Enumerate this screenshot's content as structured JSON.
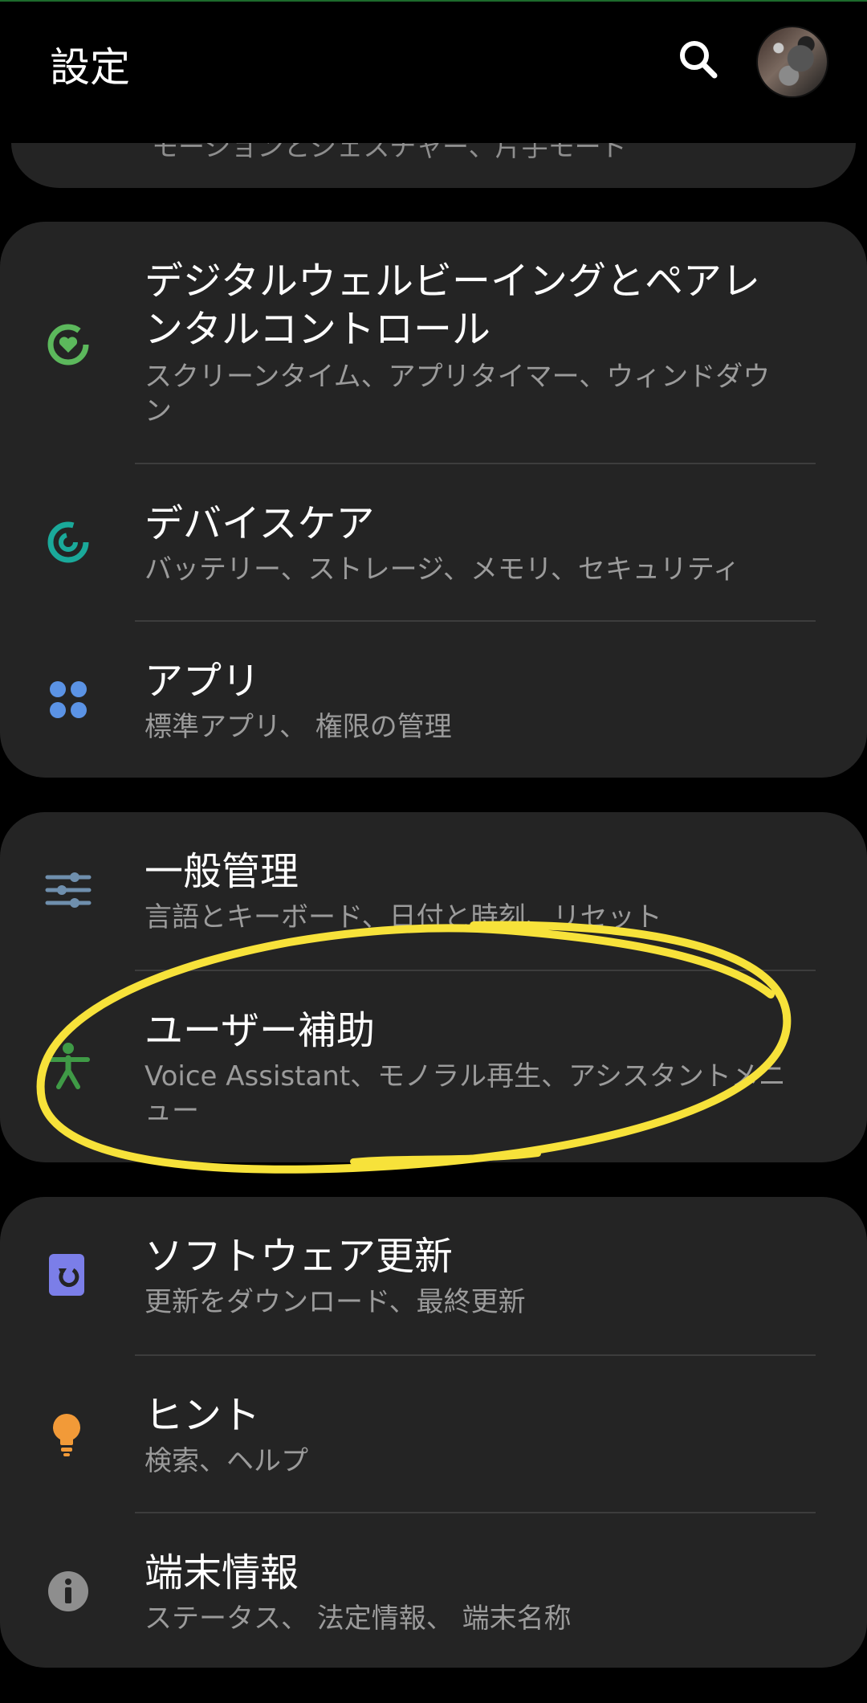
{
  "header": {
    "title": "設定",
    "search_icon": "search-icon",
    "avatar_icon": "profile-avatar"
  },
  "peek_item": {
    "subtitle": "モーションとジェスチャー、片手モード"
  },
  "groups": [
    {
      "items": [
        {
          "title": "デジタルウェルビーイングとペアレンタルコントロール",
          "subtitle": "スクリーンタイム、アプリタイマー、ウィンドダウン",
          "icon": "digital-wellbeing-icon",
          "color": "#5cb85c"
        },
        {
          "title": "デバイスケア",
          "subtitle": "バッテリー、ストレージ、メモリ、セキュリティ",
          "icon": "device-care-icon",
          "color": "#1aa99a"
        },
        {
          "title": "アプリ",
          "subtitle": "標準アプリ、 権限の管理",
          "icon": "apps-icon",
          "color": "#5b93e5"
        }
      ]
    },
    {
      "items": [
        {
          "title": "一般管理",
          "subtitle": "言語とキーボード、日付と時刻、リセット",
          "icon": "general-management-icon",
          "color": "#6f8fad"
        },
        {
          "title": "ユーザー補助",
          "subtitle": "Voice Assistant、モノラル再生、アシスタントメニュー",
          "icon": "accessibility-icon",
          "color": "#3f9a46"
        }
      ]
    },
    {
      "items": [
        {
          "title": "ソフトウェア更新",
          "subtitle": "更新をダウンロード、最終更新",
          "icon": "software-update-icon",
          "color": "#7b7ee8"
        },
        {
          "title": "ヒント",
          "subtitle": "検索、ヘルプ",
          "icon": "tips-lightbulb-icon",
          "color": "#f29a38"
        },
        {
          "title": "端末情報",
          "subtitle": "ステータス、 法定情報、 端末名称",
          "icon": "about-phone-info-icon",
          "color": "#8e8e8e"
        }
      ]
    }
  ],
  "colors": {
    "background": "#000000",
    "card": "#242424",
    "annotation": "#f7e23a"
  }
}
